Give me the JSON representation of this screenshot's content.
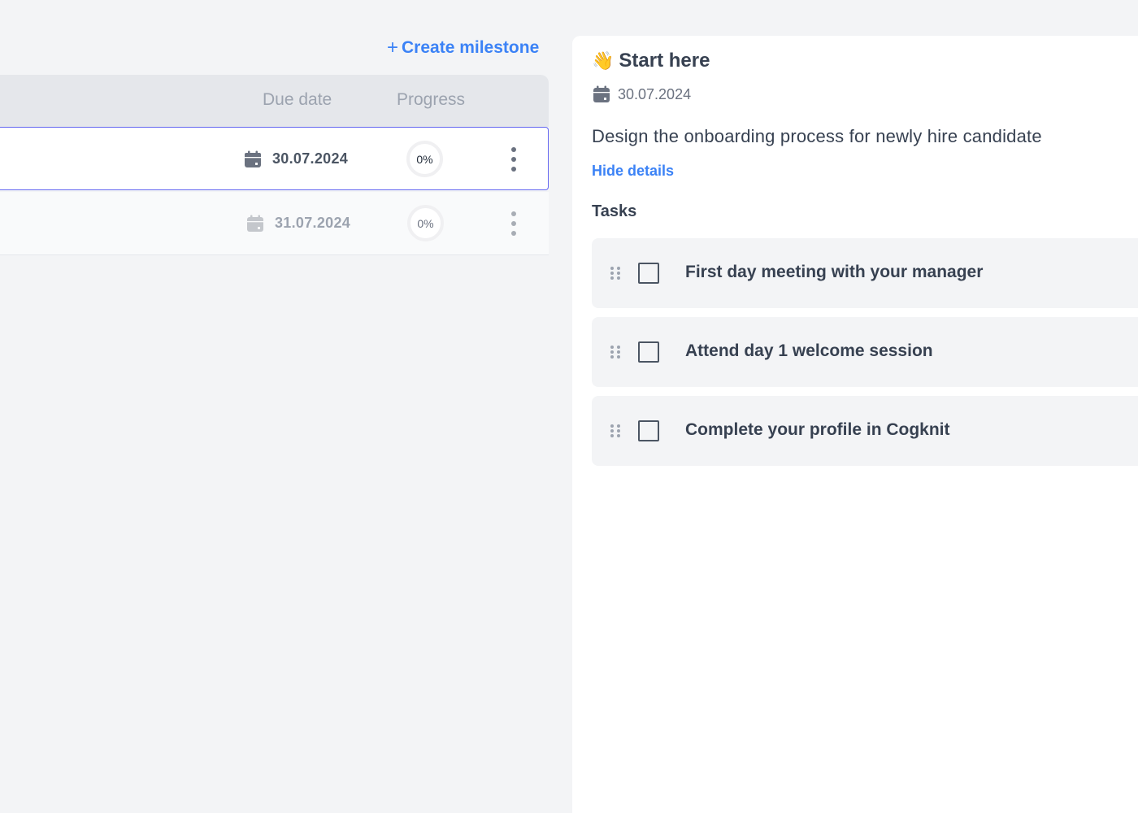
{
  "toolbar": {
    "create_label": "Create milestone",
    "create_icon": "plus-icon"
  },
  "table": {
    "columns": {
      "due_date": "Due date",
      "progress": "Progress"
    },
    "rows": [
      {
        "date": "30.07.2024",
        "progress": "0%",
        "selected": true
      },
      {
        "date": "31.07.2024",
        "progress": "0%",
        "selected": false
      }
    ]
  },
  "details": {
    "emoji": "👋",
    "title": "Start here",
    "date": "30.07.2024",
    "description": "Design the onboarding process for newly hire candidate",
    "toggle_label": "Hide details",
    "tasks_heading": "Tasks",
    "tasks": [
      {
        "label": "First day meeting with your manager",
        "checked": false
      },
      {
        "label": "Attend day 1 welcome session",
        "checked": false
      },
      {
        "label": "Complete your profile in Cogknit",
        "checked": false
      }
    ]
  },
  "colors": {
    "accent": "#3b82f6",
    "selected_border": "#6366f1",
    "background": "#f3f4f6"
  }
}
